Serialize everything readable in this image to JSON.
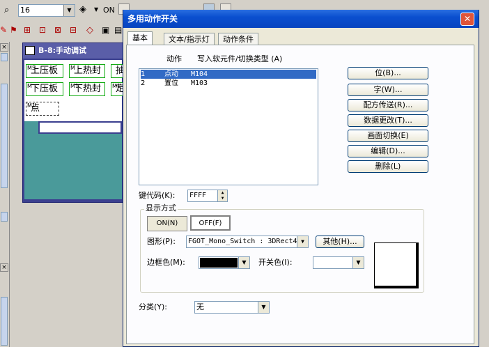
{
  "background": {
    "zoom_value": "16",
    "on_label": "ON",
    "screen_window": {
      "title": "B-8:手动调试",
      "buttons": [
        {
          "tag": "M5",
          "label": "上压板"
        },
        {
          "tag": "M",
          "label": "上热封"
        },
        {
          "tag": "M",
          "label": "抽"
        },
        {
          "tag": "M",
          "label": "下压板"
        },
        {
          "tag": "M1",
          "label": "下热封"
        },
        {
          "tag": "M1",
          "label": "定"
        },
        {
          "tag": "M1",
          "label": "点"
        }
      ]
    },
    "panel_close": "×"
  },
  "dialog": {
    "title": "多用动作开关",
    "close": "✕",
    "tabs": [
      "基本",
      "文本/指示灯",
      "动作条件"
    ],
    "list_header": {
      "action": "动作",
      "target": "写入软元件/切换类型 (A)"
    },
    "actions": [
      {
        "no": "1",
        "action": "点动",
        "device": "M104",
        "selected": true
      },
      {
        "no": "2",
        "action": "置位",
        "device": "M103",
        "selected": false
      }
    ],
    "buttons": {
      "bit": "位(B)...",
      "word": "字(W)...",
      "recipe": "配方传送(R)...",
      "data_change": "数据更改(T)...",
      "screen_switch": "画面切换(E)",
      "edit": "编辑(D)...",
      "delete": "删除(L)"
    },
    "keycode_label": "键代码(K):",
    "keycode_value": "FFFF",
    "display": {
      "legend": "显示方式",
      "on": "ON(N)",
      "off": "OFF(F)",
      "shape_label": "图形(P):",
      "shape_value": "FGOT_Mono_Switch : 3DRect4",
      "other": "其他(H)...",
      "border_color_label": "边框色(M):",
      "border_color": "#000000",
      "switch_color_label": "开关色(I):",
      "switch_color": "#ffffff"
    },
    "category_label": "分类(Y):",
    "category_value": "无"
  }
}
